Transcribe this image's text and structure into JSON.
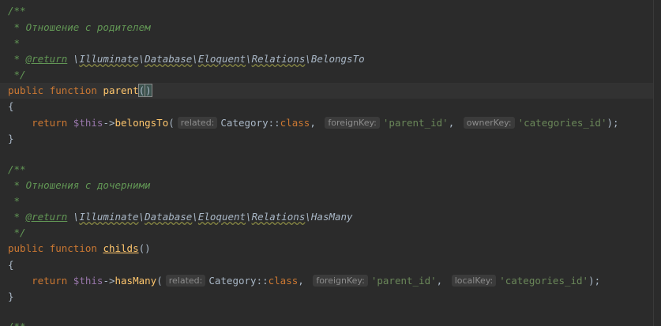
{
  "block1": {
    "doc_open": "/**",
    "doc_desc": " * Отношение с родителем",
    "doc_blank": " *",
    "doc_return_prefix": " * ",
    "doc_return_tag": "@return",
    "doc_return_sp": " ",
    "doc_ref_bs1": "\\",
    "doc_ref_illuminate": "Illuminate",
    "doc_ref_bs2": "\\",
    "doc_ref_database": "Database",
    "doc_ref_bs3": "\\",
    "doc_ref_eloquent": "Eloquent",
    "doc_ref_bs4": "\\",
    "doc_ref_relations": "Relations",
    "doc_ref_bs5": "\\",
    "doc_ref_class": "BelongsTo",
    "doc_close": " */",
    "kw_public": "public",
    "kw_function": "function",
    "fn_name": "parent",
    "paren_open": "(",
    "paren_close": ")",
    "brace_open": "{",
    "indent": "    ",
    "kw_return": "return",
    "this": "$this",
    "arrow": "->",
    "call": "belongsTo",
    "call_open": "(",
    "hint1": "related:",
    "arg1": "Category",
    "dc": "::",
    "kw_class": "class",
    "comma": ",",
    "hint2": "foreignKey:",
    "arg2": "'parent_id'",
    "hint3": "ownerKey:",
    "arg3": "'categories_id'",
    "call_close": ");",
    "brace_close": "}"
  },
  "block2": {
    "doc_open": "/**",
    "doc_desc": " * Отношения с дочерними",
    "doc_blank": " *",
    "doc_return_prefix": " * ",
    "doc_return_tag": "@return",
    "doc_return_sp": " ",
    "doc_ref_bs1": "\\",
    "doc_ref_illuminate": "Illuminate",
    "doc_ref_bs2": "\\",
    "doc_ref_database": "Database",
    "doc_ref_bs3": "\\",
    "doc_ref_eloquent": "Eloquent",
    "doc_ref_bs4": "\\",
    "doc_ref_relations": "Relations",
    "doc_ref_bs5": "\\",
    "doc_ref_class": "HasMany",
    "doc_close": " */",
    "kw_public": "public",
    "kw_function": "function",
    "fn_name": "childs",
    "parens": "()",
    "brace_open": "{",
    "indent": "    ",
    "kw_return": "return",
    "this": "$this",
    "arrow": "->",
    "call": "hasMany",
    "call_open": "(",
    "hint1": "related:",
    "arg1": "Category",
    "dc": "::",
    "kw_class": "class",
    "comma": ",",
    "hint2": "foreignKey:",
    "arg2": "'parent_id'",
    "hint3": "localKey:",
    "arg3": "'categories_id'",
    "call_close": ");",
    "brace_close": "}"
  },
  "block3": {
    "doc_open": "/**"
  },
  "colors": {
    "background": "#2b2b2b",
    "current_line": "#323232",
    "doc_comment": "#629755",
    "keyword": "#cc7832",
    "function": "#ffc66d",
    "variable": "#9876aa",
    "string": "#6a8759",
    "text": "#a9b7c6",
    "hint_bg": "#3b3b3b",
    "hint_fg": "#8c8c8c"
  }
}
